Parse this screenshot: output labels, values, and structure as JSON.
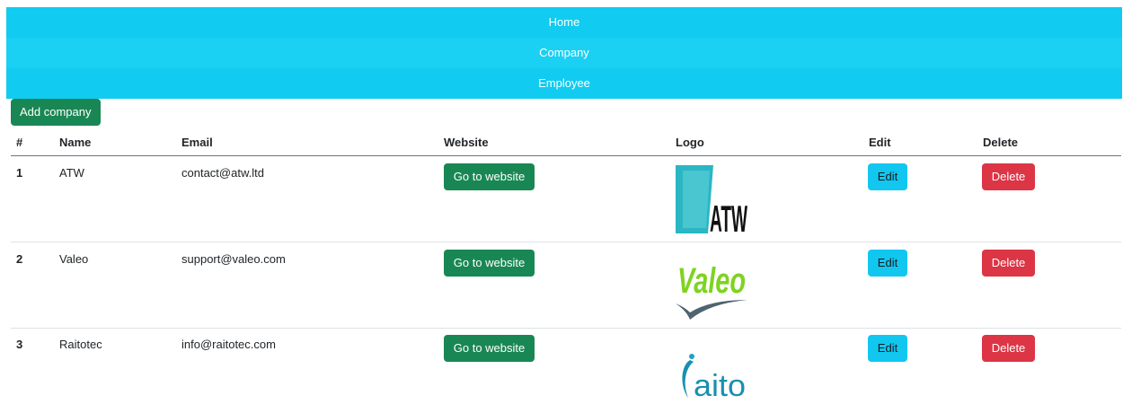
{
  "nav": {
    "items": [
      "Home",
      "Company",
      "Employee"
    ]
  },
  "actions": {
    "add_company": "Add company"
  },
  "table": {
    "headers": [
      "#",
      "Name",
      "Email",
      "Website",
      "Logo",
      "Edit",
      "Delete"
    ],
    "rows": [
      {
        "num": "1",
        "name": "ATW",
        "email": "contact@atw.ltd",
        "website": "Go to website",
        "logo_text": "ATW",
        "edit": "Edit",
        "delete": "Delete"
      },
      {
        "num": "2",
        "name": "Valeo",
        "email": "support@valeo.com",
        "website": "Go to website",
        "logo_text": "Valeo",
        "edit": "Edit",
        "delete": "Delete"
      },
      {
        "num": "3",
        "name": "Raitotec",
        "email": "info@raitotec.com",
        "website": "Go to website",
        "logo_text": "aito",
        "edit": "Edit",
        "delete": "Delete"
      }
    ]
  },
  "colors": {
    "nav": "#11cbf0",
    "success": "#198754",
    "info": "#11c7f0",
    "danger": "#dc3545"
  }
}
